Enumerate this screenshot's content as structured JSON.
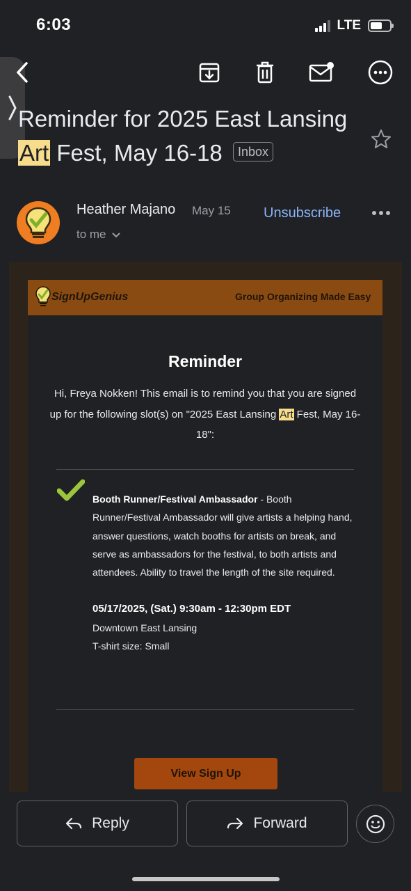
{
  "status_bar": {
    "time": "6:03",
    "network": "LTE",
    "battery_level": 0.6
  },
  "toolbar": {
    "icons": [
      "back-chevron-icon",
      "archive-icon",
      "trash-icon",
      "mark-unread-icon",
      "more-options-icon"
    ]
  },
  "email": {
    "subject_before": "Reminder for 2025 East Lansing",
    "subject_highlight": "Art",
    "subject_after": " Fest, May 16-18",
    "label": "Inbox",
    "sender_name": "Heather Majano",
    "date": "May 15",
    "recipient": "to me",
    "unsubscribe": "Unsubscribe"
  },
  "body": {
    "logo_text": "SignUpGenius",
    "tagline": "Group Organizing Made Easy",
    "title": "Reminder",
    "intro_before": "Hi, Freya Nokken! This email is to remind you that you are signed up for the following slot(s) on \"2025 East Lansing ",
    "intro_highlight": "Art",
    "intro_after": " Fest, May 16-18\":",
    "slot_title": "Booth Runner/Festival Ambassador",
    "slot_desc": " - Booth Runner/Festival Ambassador will give artists a helping hand, answer questions, watch booths for artists on break, and serve as ambassadors for the festival, to both artists and attendees. Ability to travel the length of the site required.",
    "slot_datetime": "05/17/2025, (Sat.) 9:30am - 12:30pm EDT",
    "slot_location": "Downtown East Lansing",
    "slot_shirt": "T-shirt size: Small",
    "button": "View Sign Up"
  },
  "actions": {
    "reply": "Reply",
    "forward": "Forward"
  },
  "colors": {
    "accent": "#8ab4f8",
    "brand": "#8a4b12",
    "highlight": "#f7dd8b",
    "avatar": "#ef7d22",
    "check": "#9bc53d"
  }
}
